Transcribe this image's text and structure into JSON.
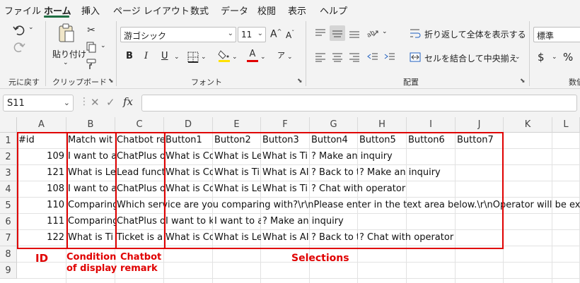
{
  "menu": {
    "items": [
      "ファイル",
      "ホーム",
      "挿入",
      "ページ レイアウト",
      "数式",
      "データ",
      "校閲",
      "表示",
      "ヘルプ"
    ],
    "active": "ホーム"
  },
  "ribbon": {
    "undo": {
      "label": "元に戻す"
    },
    "clipboard": {
      "paste_label": "貼り付け",
      "group_label": "クリップボード"
    },
    "font": {
      "name": "游ゴシック",
      "size": "11",
      "group_label": "フォント",
      "bold": "B",
      "italic": "I",
      "underline": "U",
      "grow": "A",
      "shrink": "A",
      "phonetic": "ア",
      "color_letter": "A"
    },
    "alignment": {
      "wrap_text": "折り返して全体を表示する",
      "merge_center": "セルを結合して中央揃え",
      "group_label": "配置"
    },
    "number": {
      "format": "標準",
      "currency": "$",
      "percent": "%",
      "group_label": "数値"
    }
  },
  "formula_bar": {
    "name_box": "S11",
    "fx": "fx",
    "value": ""
  },
  "grid": {
    "columns": [
      "A",
      "B",
      "C",
      "D",
      "E",
      "F",
      "G",
      "H",
      "I",
      "J",
      "K",
      "L"
    ],
    "rows": [
      "1",
      "2",
      "3",
      "4",
      "5",
      "6",
      "7",
      "8",
      "9"
    ],
    "cells": {
      "r1": [
        "#id",
        "Match wit",
        "Chatbot re",
        "Button1",
        "Button2",
        "Button3",
        "Button4",
        "Button5",
        "Button6",
        "Button7"
      ],
      "r2": [
        "109",
        "I want to a",
        "ChatPlus o",
        "What is Co",
        "What is Le",
        "What is Ti",
        "? Make an inquiry"
      ],
      "r3": [
        "121",
        "What is Le",
        "Lead funct",
        "What is Co",
        "What is Ti",
        "What is AI",
        "? Back to t",
        "? Make an inquiry"
      ],
      "r4": [
        "108",
        "I want to a",
        "ChatPlus o",
        "What is Co",
        "What is Le",
        "What is Ti",
        "? Chat with operator"
      ],
      "r5": [
        "110",
        "Comparing",
        "Which service are you comparing with?\\r\\nPlease enter in the text area below.\\r\\nOperator will be ex"
      ],
      "r6": [
        "111",
        "Comparing",
        "ChatPlus o",
        "I want to k",
        "I want to a",
        "? Make an inquiry"
      ],
      "r7": [
        "122",
        "What is Ti",
        "Ticket is a",
        "What is Co",
        "What is Le",
        "What is AI",
        "? Back to t",
        "? Chat with operator"
      ]
    }
  },
  "annotations": {
    "id": "ID",
    "condition": "Condition\nof display",
    "remark": "Chatbot\nremark",
    "selections": "Selections"
  },
  "colors": {
    "annotation_red": "#e00000",
    "excel_green": "#1f6e43"
  }
}
